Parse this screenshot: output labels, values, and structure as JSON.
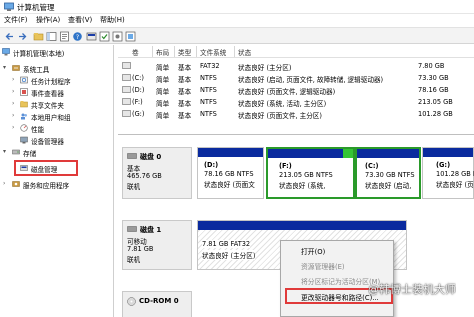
{
  "window": {
    "title": "计算机管理"
  },
  "menubar": {
    "items": [
      "文件(F)",
      "操作(A)",
      "查看(V)",
      "帮助(H)"
    ]
  },
  "tree": {
    "root": "计算机管理(本地)",
    "items": [
      {
        "label": "系统工具",
        "level": 1,
        "icon": "tools-icon"
      },
      {
        "label": "任务计划程序",
        "level": 2,
        "icon": "clock-icon"
      },
      {
        "label": "事件查看器",
        "level": 2,
        "icon": "event-icon"
      },
      {
        "label": "共享文件夹",
        "level": 2,
        "icon": "folder-icon"
      },
      {
        "label": "本地用户和组",
        "level": 2,
        "icon": "users-icon"
      },
      {
        "label": "性能",
        "level": 2,
        "icon": "performance-icon"
      },
      {
        "label": "设备管理器",
        "level": 2,
        "icon": "device-icon"
      },
      {
        "label": "存储",
        "level": 1,
        "icon": "storage-icon"
      },
      {
        "label": "磁盘管理",
        "level": 2,
        "icon": "disk-icon",
        "selected": true
      },
      {
        "label": "服务和应用程序",
        "level": 1,
        "icon": "services-icon"
      }
    ]
  },
  "volume_table": {
    "headers": [
      "卷",
      "布局",
      "类型",
      "文件系统",
      "状态"
    ],
    "rows": [
      {
        "volume": "",
        "layout": "简单",
        "type": "基本",
        "fs": "FAT32",
        "status": "状态良好 (主分区)",
        "cap": "7.80 GB"
      },
      {
        "volume": "(C:)",
        "layout": "简单",
        "type": "基本",
        "fs": "NTFS",
        "status": "状态良好 (启动, 页面文件, 故障转储, 逻辑驱动器)",
        "cap": "73.30 GB"
      },
      {
        "volume": "(D:)",
        "layout": "简单",
        "type": "基本",
        "fs": "NTFS",
        "status": "状态良好 (页面文件, 逻辑驱动器)",
        "cap": "78.16 GB"
      },
      {
        "volume": "(F:)",
        "layout": "简单",
        "type": "基本",
        "fs": "NTFS",
        "status": "状态良好 (系统, 活动, 主分区)",
        "cap": "213.05 GB"
      },
      {
        "volume": "(G:)",
        "layout": "简单",
        "type": "基本",
        "fs": "NTFS",
        "status": "状态良好 (页面文件, 主分区)",
        "cap": "101.28 GB"
      }
    ]
  },
  "disks": [
    {
      "name": "磁盘 0",
      "type": "基本",
      "size": "465.76 GB",
      "state": "联机",
      "partitions": [
        {
          "name": "(D:)",
          "size": "78.16 GB NTFS",
          "status": "状态良好 (页面文"
        },
        {
          "name": "(F:)",
          "size": "213.05 GB NTFS",
          "status": "状态良好 (系统, ",
          "selected": true
        },
        {
          "name": "(C:)",
          "size": "73.30 GB NTFS",
          "status": "状态良好 (启动,"
        },
        {
          "name": "(G:)",
          "size": "101.28 GB NTFS",
          "status": "状态良好 (页面文"
        }
      ]
    },
    {
      "name": "磁盘 1",
      "type": "可移动",
      "size": "7.81 GB",
      "state": "联机",
      "partitions": [
        {
          "name": "",
          "size": "7.81 GB FAT32",
          "status": "状态良好 (主分区)"
        }
      ]
    },
    {
      "name": "CD-ROM 0"
    }
  ],
  "context_menu": {
    "items": [
      {
        "label": "打开(O)",
        "enabled": true
      },
      {
        "label": "资源管理器(E)",
        "enabled": false
      },
      {
        "label": "将分区标记为活动分区(M)",
        "enabled": false
      },
      {
        "label": "更改驱动器号和路径(C)...",
        "enabled": true,
        "highlighted": true
      }
    ]
  },
  "watermark": "@韩博士装机大师",
  "colors": {
    "partition_header": "#0a2a9e",
    "selected_border": "#2a9a2a",
    "highlight": "#e03a3a"
  }
}
